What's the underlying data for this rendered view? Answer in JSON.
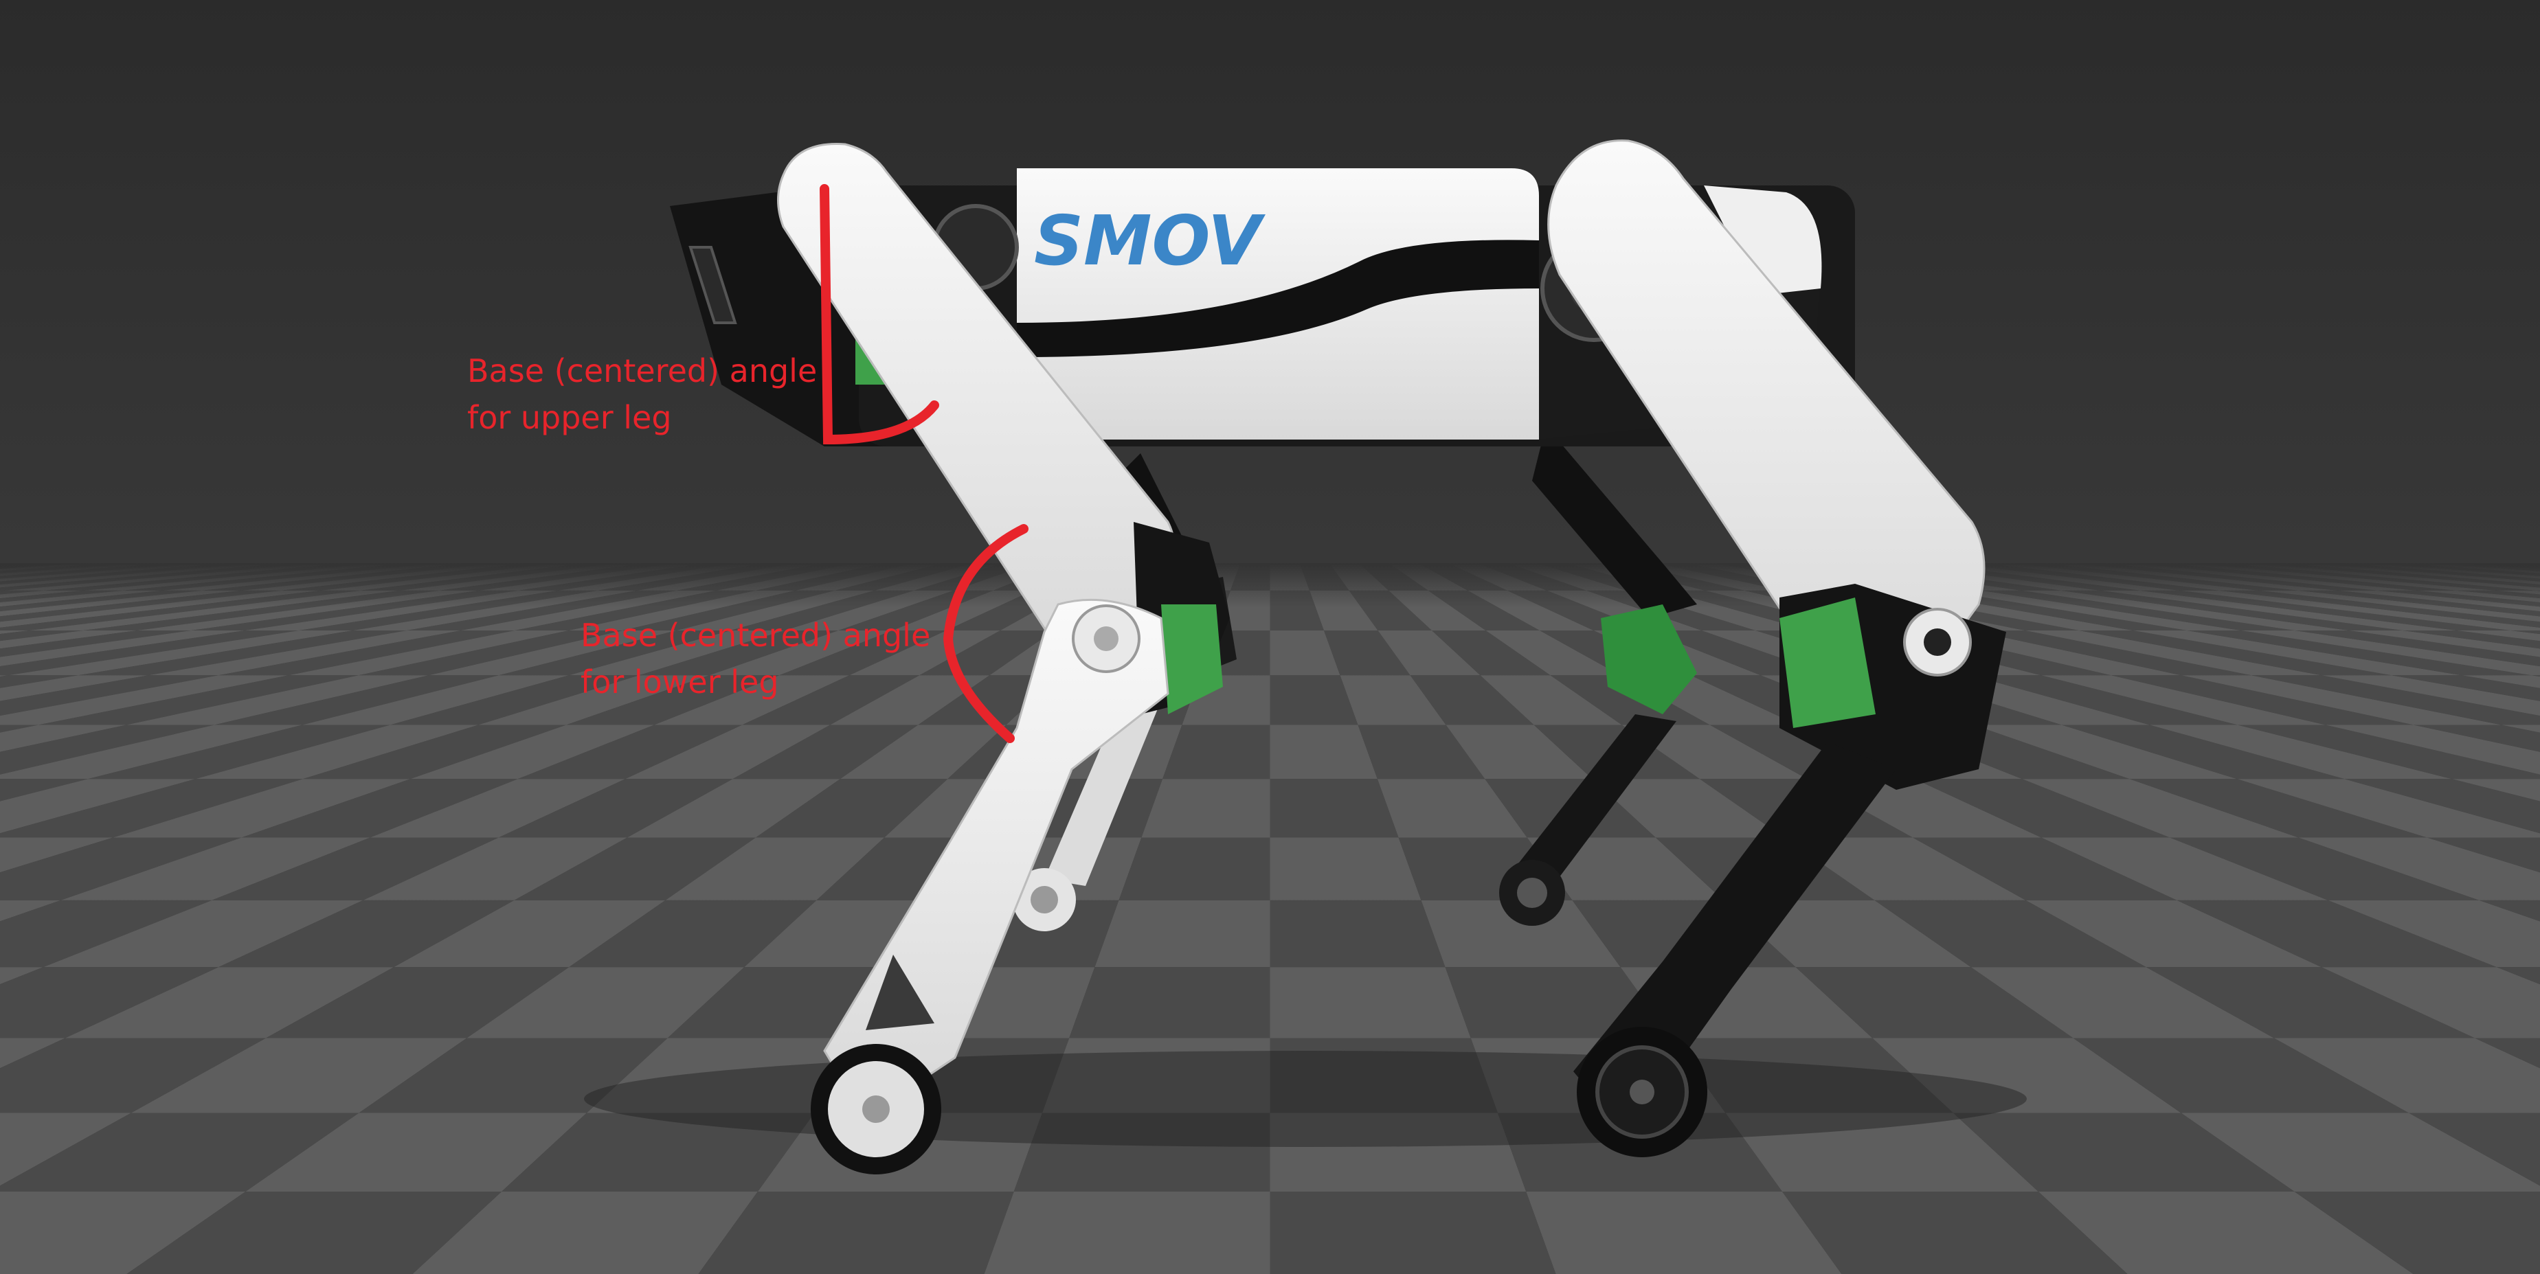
{
  "scene": {
    "subject": "SMOV quadruped robot, side view on checkerboard floor",
    "logo_text": "SMOV",
    "colors": {
      "background": "#2e2e2e",
      "annotation": "#e8242b",
      "body": "#f2f2f2",
      "accent": "#3fa14a",
      "logo": "#3b86c8"
    }
  },
  "annotations": {
    "upper_leg": {
      "line1": "Base (centered) angle",
      "line2": "for upper leg"
    },
    "lower_leg": {
      "line1": "Base (centered) angle",
      "line2": "for lower leg"
    }
  }
}
